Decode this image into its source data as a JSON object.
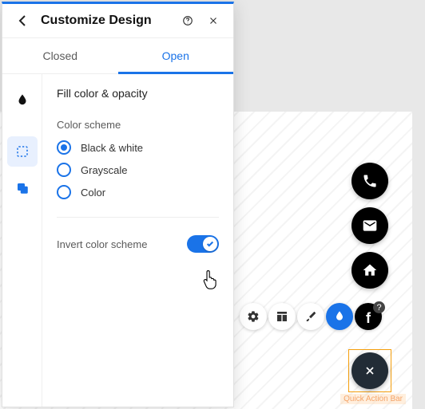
{
  "panel": {
    "title": "Customize Design",
    "tabs": [
      {
        "label": "Closed",
        "active": false
      },
      {
        "label": "Open",
        "active": true
      }
    ],
    "sidebar_items": [
      {
        "name": "drop-icon",
        "active": false
      },
      {
        "name": "selection-icon",
        "active": true
      },
      {
        "name": "layers-icon",
        "active": false
      }
    ],
    "section_title": "Fill color & opacity",
    "color_scheme_label": "Color scheme",
    "radio_options": [
      {
        "label": "Black & white",
        "selected": true
      },
      {
        "label": "Grayscale",
        "selected": false
      },
      {
        "label": "Color",
        "selected": false
      }
    ],
    "invert_label": "Invert color scheme",
    "invert_toggle_on": true
  },
  "floating": {
    "buttons": [
      "phone-icon",
      "email-icon",
      "home-icon"
    ],
    "close_label": "Quick Action Bar"
  },
  "toolbar": {
    "items": [
      "gear-icon",
      "layout-icon",
      "brush-icon",
      "drop-icon",
      "facebook-icon"
    ]
  }
}
